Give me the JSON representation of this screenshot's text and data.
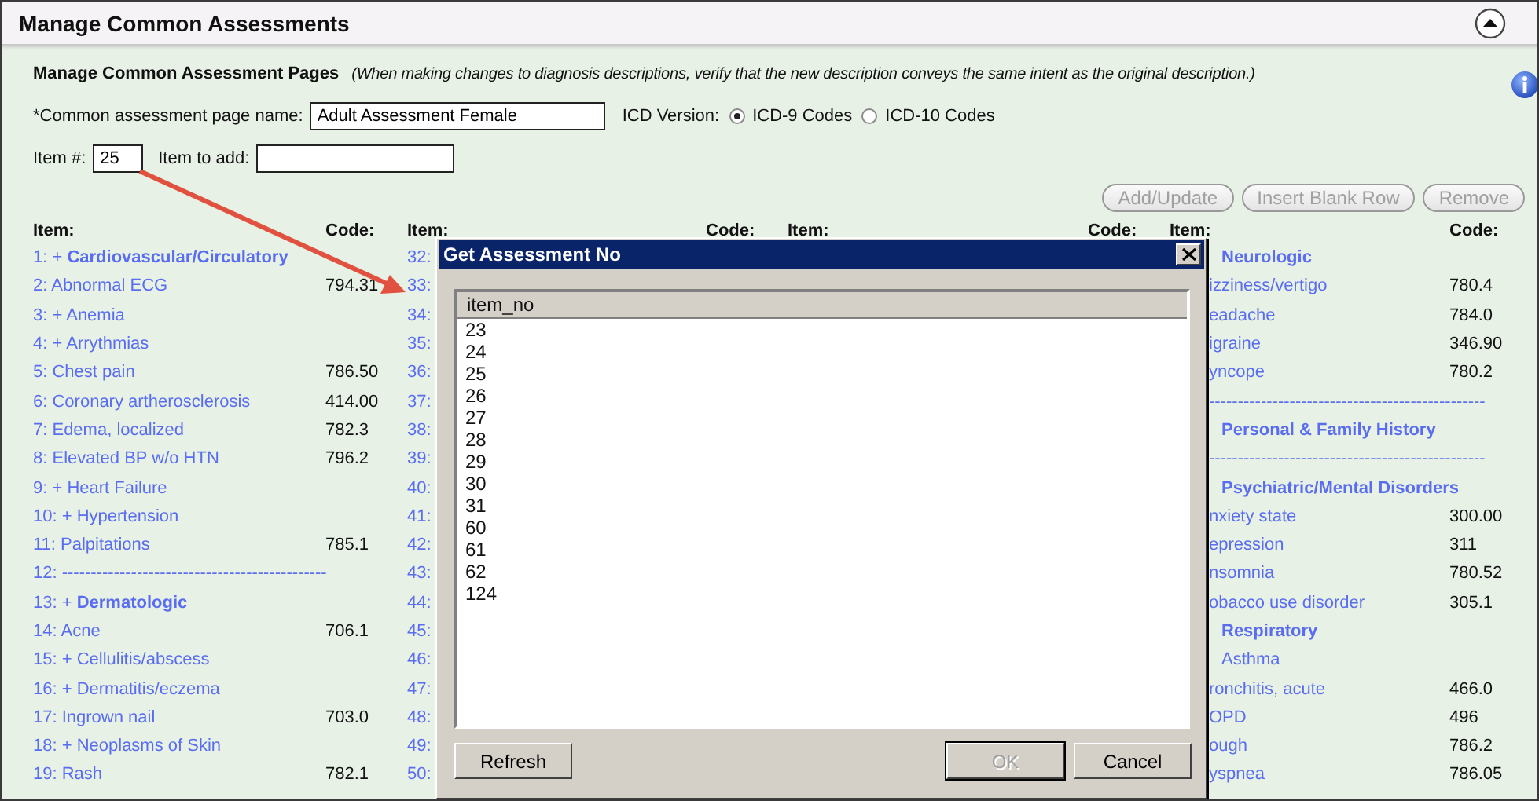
{
  "header": {
    "title": "Manage Common Assessments"
  },
  "section": {
    "title": "Manage Common Assessment Pages",
    "note": "(When making changes to diagnosis descriptions, verify that the new description conveys the same intent as the original description.)"
  },
  "form": {
    "page_name_label": "*Common assessment page name:",
    "page_name": "Adult Assessment Female",
    "icd_label": "ICD Version:",
    "icd_options": [
      {
        "label": "ICD-9 Codes",
        "selected": true
      },
      {
        "label": "ICD-10 Codes",
        "selected": false
      }
    ],
    "item_no_label": "Item #:",
    "item_no": "25",
    "item_to_add_label": "Item to add:"
  },
  "buttons": [
    {
      "label": "Add/Update",
      "disabled": true
    },
    {
      "label": "Insert Blank Row",
      "disabled": true
    },
    {
      "label": "Remove",
      "disabled": true
    }
  ],
  "columns": [
    {
      "item_header": "Item:",
      "code_header": "Code:",
      "rows": [
        {
          "kind": "heading",
          "text": "1: + **Cardiovascular/Circulatory**"
        },
        {
          "kind": "item",
          "text": "2: Abnormal ECG",
          "code": "794.31"
        },
        {
          "kind": "group",
          "text": "3: + Anemia"
        },
        {
          "kind": "group",
          "text": "4: + Arrythmias"
        },
        {
          "kind": "item",
          "text": "5: Chest pain",
          "code": "786.50"
        },
        {
          "kind": "item",
          "text": "6: Coronary artherosclerosis",
          "code": "414.00"
        },
        {
          "kind": "item",
          "text": "7: Edema, localized",
          "code": "782.3"
        },
        {
          "kind": "item",
          "text": "8: Elevated BP w/o HTN",
          "code": "796.2"
        },
        {
          "kind": "group",
          "text": "9: + Heart Failure"
        },
        {
          "kind": "group",
          "text": "10: + Hypertension"
        },
        {
          "kind": "item",
          "text": "11: Palpitations",
          "code": "785.1"
        },
        {
          "kind": "divider",
          "text": "12: ----------------------------------------------"
        },
        {
          "kind": "heading",
          "text": "13: + **Dermatologic**"
        },
        {
          "kind": "item",
          "text": "14: Acne",
          "code": "706.1"
        },
        {
          "kind": "group",
          "text": "15: + Cellulitis/abscess"
        },
        {
          "kind": "group",
          "text": "16: + Dermatitis/eczema"
        },
        {
          "kind": "item",
          "text": "17: Ingrown nail",
          "code": "703.0"
        },
        {
          "kind": "group",
          "text": "18: + Neoplasms of Skin"
        },
        {
          "kind": "item",
          "text": "19: Rash",
          "code": "782.1"
        }
      ]
    },
    {
      "item_header": "Item:",
      "code_header": "Code:",
      "rows": [
        {
          "kind": "item",
          "text": "32:"
        },
        {
          "kind": "item",
          "text": "33:"
        },
        {
          "kind": "item",
          "text": "34:"
        },
        {
          "kind": "item",
          "text": "35:"
        },
        {
          "kind": "item",
          "text": "36:"
        },
        {
          "kind": "item",
          "text": "37:"
        },
        {
          "kind": "item",
          "text": "38:"
        },
        {
          "kind": "item",
          "text": "39:"
        },
        {
          "kind": "item",
          "text": "40:"
        },
        {
          "kind": "item",
          "text": "41:"
        },
        {
          "kind": "item",
          "text": "42:"
        },
        {
          "kind": "item",
          "text": "43:"
        },
        {
          "kind": "item",
          "text": "44:"
        },
        {
          "kind": "item",
          "text": "45:"
        },
        {
          "kind": "item",
          "text": "46:"
        },
        {
          "kind": "item",
          "text": "47:"
        },
        {
          "kind": "item",
          "text": "48:"
        },
        {
          "kind": "item",
          "text": "49:"
        },
        {
          "kind": "item",
          "text": "50:"
        }
      ]
    },
    {
      "item_header": "Item:",
      "code_header": "Code:"
    },
    {
      "item_header": "Item:",
      "code_header": "Code:",
      "rows": [
        {
          "kind": "heading",
          "text": "Neurologic"
        },
        {
          "kind": "item",
          "text": "izziness/vertigo",
          "code": "780.4"
        },
        {
          "kind": "item",
          "text": "eadache",
          "code": "784.0"
        },
        {
          "kind": "item",
          "text": "igraine",
          "code": "346.90"
        },
        {
          "kind": "item",
          "text": "yncope",
          "code": "780.2"
        },
        {
          "kind": "divider",
          "text": "------------------------------------------------"
        },
        {
          "kind": "heading",
          "text": "Personal & Family History"
        },
        {
          "kind": "divider",
          "text": "------------------------------------------------"
        },
        {
          "kind": "heading",
          "text": "Psychiatric/Mental Disorders"
        },
        {
          "kind": "item",
          "text": "nxiety state",
          "code": "300.00"
        },
        {
          "kind": "item",
          "text": "epression",
          "code": "311"
        },
        {
          "kind": "item",
          "text": "nsomnia",
          "code": "780.52"
        },
        {
          "kind": "item",
          "text": "obacco use disorder",
          "code": "305.1"
        },
        {
          "kind": "heading",
          "text": "Respiratory"
        },
        {
          "kind": "group",
          "text": "Asthma"
        },
        {
          "kind": "item",
          "text": "ronchitis, acute",
          "code": "466.0"
        },
        {
          "kind": "item",
          "text": "OPD",
          "code": "496"
        },
        {
          "kind": "item",
          "text": "ough",
          "code": "786.2"
        },
        {
          "kind": "item",
          "text": "yspnea",
          "code": "786.05"
        }
      ]
    }
  ],
  "dialog": {
    "title": "Get Assessment No",
    "column": "item_no",
    "items": [
      "23",
      "24",
      "25",
      "26",
      "27",
      "28",
      "29",
      "30",
      "31",
      "60",
      "61",
      "62",
      "124"
    ],
    "buttons": [
      {
        "label": "Refresh",
        "disabled": false,
        "default": false
      },
      {
        "label": "OK",
        "disabled": true,
        "default": true
      },
      {
        "label": "Cancel",
        "disabled": false,
        "default": false
      }
    ]
  }
}
